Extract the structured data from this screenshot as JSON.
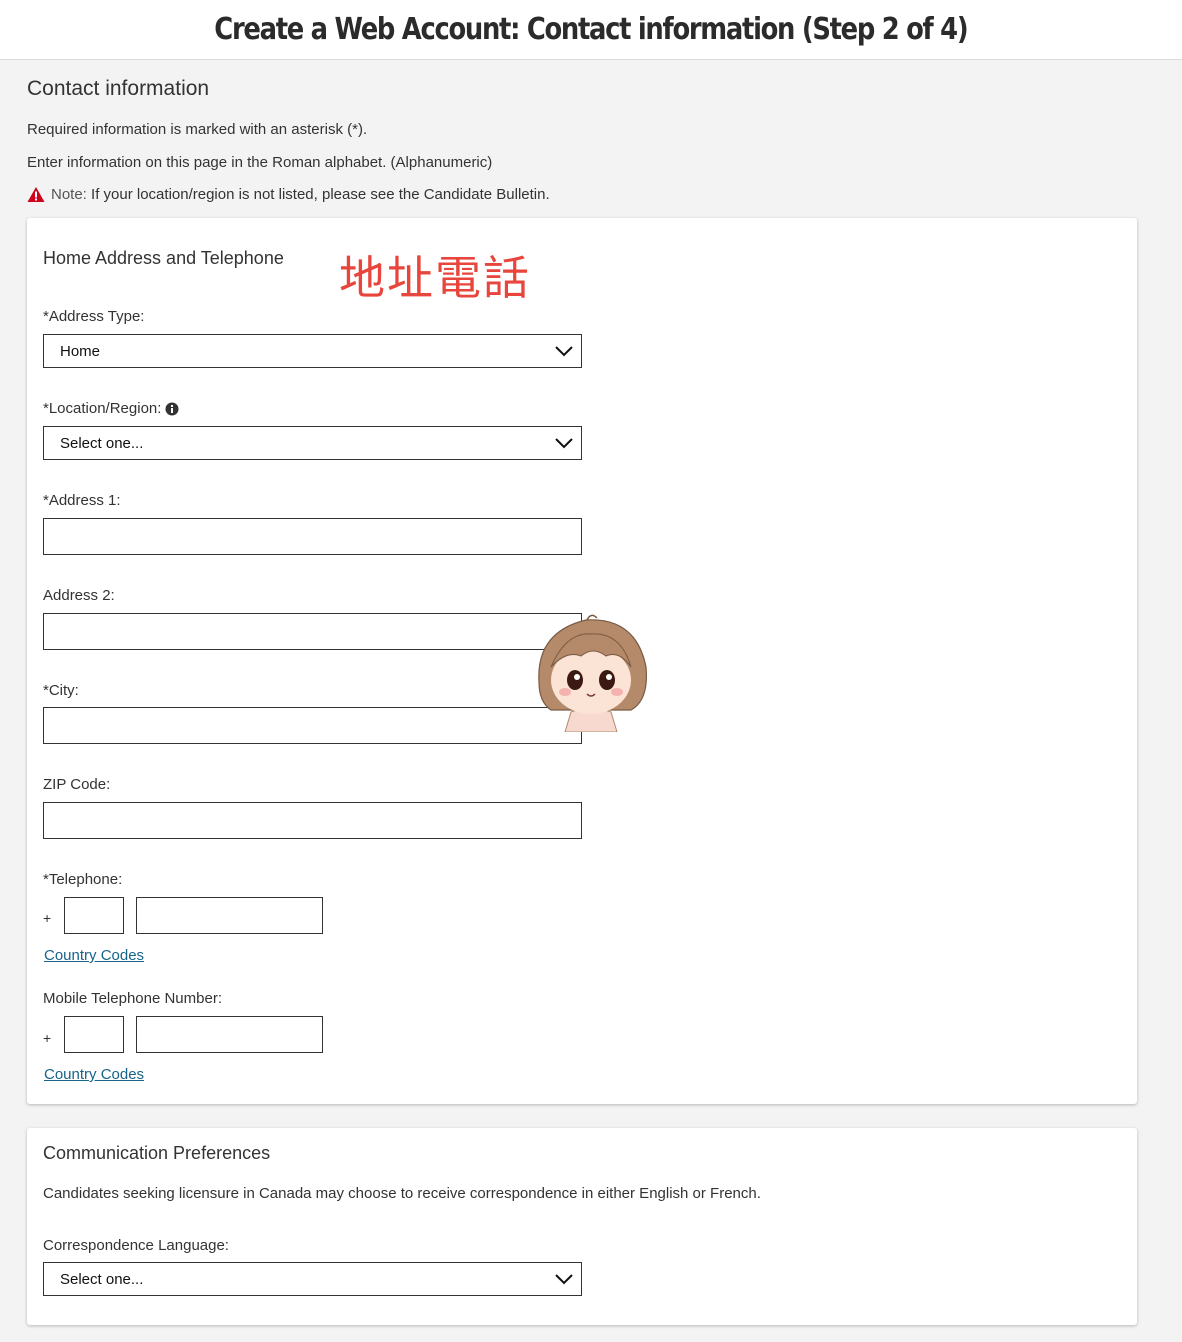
{
  "header": {
    "title": "Create a Web Account: Contact information (Step 2 of 4)"
  },
  "page": {
    "section_title": "Contact information",
    "required_note": "Required information is marked with an asterisk (*).",
    "alphabet_note": "Enter information on this page in the Roman alphabet. (Alphanumeric)",
    "note_prefix": "Note:",
    "note_text": "If your location/region is not listed, please see the Candidate Bulletin."
  },
  "home_card": {
    "title": "Home Address and Telephone",
    "annotation": "地址電話",
    "address_type": {
      "label": "*Address Type:",
      "value": "Home"
    },
    "location": {
      "label": "*Location/Region:",
      "value": "Select one..."
    },
    "address1": {
      "label": "*Address 1:",
      "value": ""
    },
    "address2": {
      "label": "Address 2:",
      "value": ""
    },
    "city": {
      "label": "*City:",
      "value": ""
    },
    "zip": {
      "label": "ZIP Code:",
      "value": ""
    },
    "telephone": {
      "label": "*Telephone:",
      "plus": "+",
      "link": "Country Codes"
    },
    "mobile": {
      "label": "Mobile Telephone Number:",
      "plus": "+",
      "link": "Country Codes"
    }
  },
  "comm_card": {
    "title": "Communication Preferences",
    "description": "Candidates seeking licensure in Canada may choose to receive correspondence in either English or French.",
    "language": {
      "label": "Correspondence Language:",
      "value": "Select one..."
    }
  },
  "colors": {
    "warning": "#d0021b",
    "link": "#17638a",
    "annotation": "#e8463c"
  }
}
